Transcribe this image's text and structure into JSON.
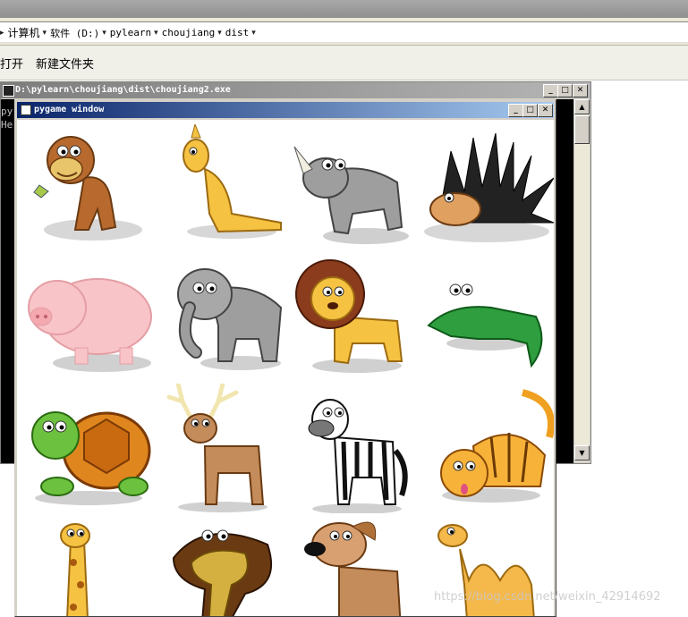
{
  "address": {
    "crumbs": [
      "计算机",
      "软件 (D:)",
      "pylearn",
      "choujiang",
      "dist"
    ]
  },
  "toolbar": {
    "open_label": "打开",
    "new_folder_label": "新建文件夹"
  },
  "console": {
    "title": "D:\\pylearn\\choujiang\\dist\\choujiang2.exe",
    "lines": [
      "py",
      "He"
    ]
  },
  "pygame": {
    "title": "pygame window",
    "animals": [
      "monkey",
      "kangaroo",
      "rhinoceros",
      "porcupine",
      "pig",
      "elephant",
      "lion",
      "crocodile",
      "turtle",
      "deer",
      "zebra",
      "tiger",
      "giraffe",
      "cobra",
      "dog",
      "camel"
    ]
  },
  "watermark": "https://blog.csdn.net/weixin_42914692",
  "colors": {
    "pygame_title_start": "#0a246a",
    "pygame_title_end": "#a6caf0",
    "console_bg": "#000000"
  }
}
